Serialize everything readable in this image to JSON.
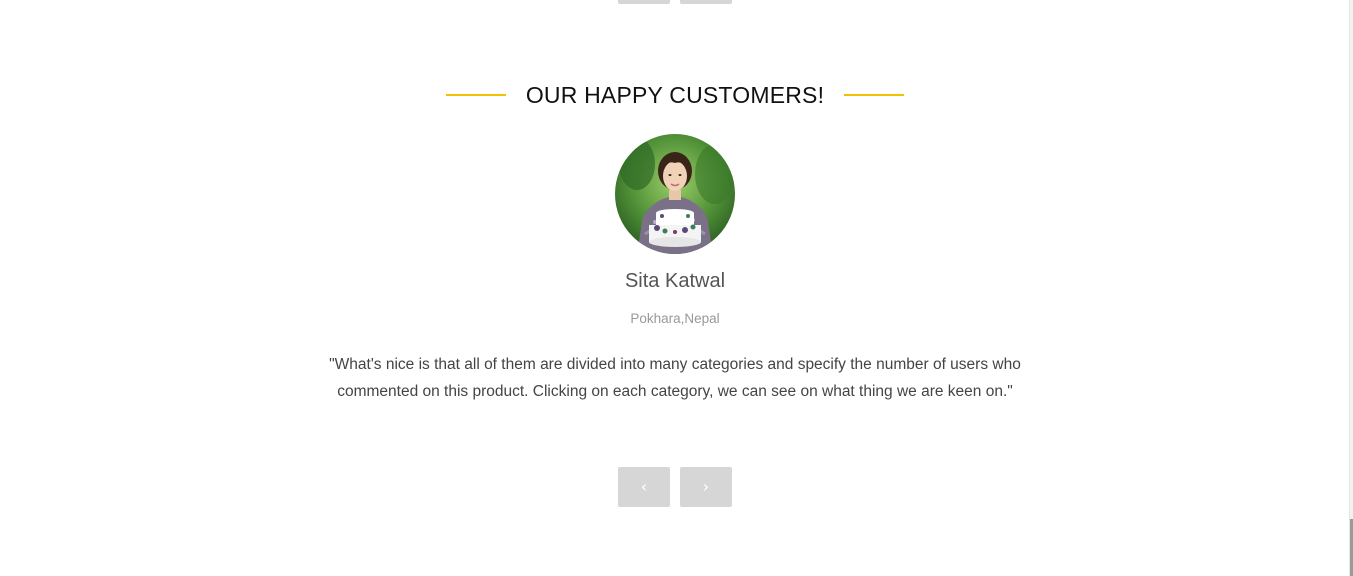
{
  "section": {
    "title": "OUR HAPPY CUSTOMERS!",
    "accent_color": "#f2c200"
  },
  "testimonial": {
    "avatar_icon": "customer-photo",
    "name": "Sita Katwal",
    "location": "Pokhara,Nepal",
    "quote": "\"What's nice is that all of them are divided into many categories and specify the number of users who commented on this product. Clicking on each category, we can see on what thing we are keen on.\""
  },
  "slider": {
    "prev_icon": "‹",
    "next_icon": "›",
    "button_color": "#d6d6d6"
  }
}
